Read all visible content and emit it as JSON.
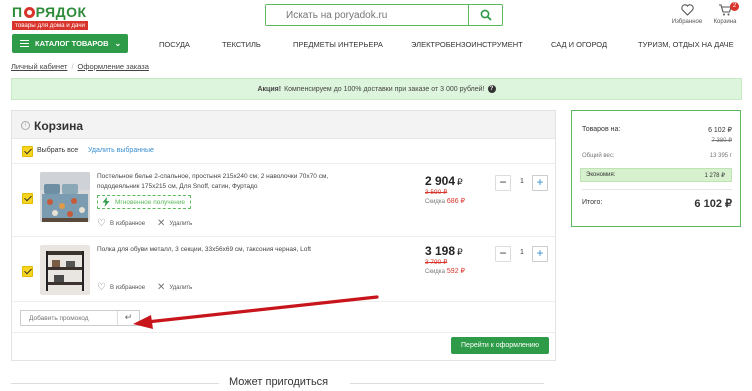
{
  "header": {
    "logo_text": "ПОРЯДОК",
    "logo_sub": "товары для дома и дачи",
    "search_placeholder": "Искать на poryadok.ru",
    "favorites_label": "Избранное",
    "cart_label": "Корзина",
    "cart_count": "2"
  },
  "nav": {
    "catalog_label": "КАТАЛОГ ТОВАРОВ",
    "items": [
      "ПОСУДА",
      "ТЕКСТИЛЬ",
      "ПРЕДМЕТЫ ИНТЕРЬЕРА",
      "ЭЛЕКТРОБЕНЗОИНСТРУМЕНТ",
      "САД И ОГОРОД",
      "ТУРИЗМ, ОТДЫХ НА ДАЧЕ"
    ]
  },
  "breadcrumb": [
    "Личный кабинет",
    "Оформление заказа"
  ],
  "promo": {
    "bold": "Акция!",
    "text": "Компенсируем до 100% доставки при заказе от 3 000 рублей!",
    "help_glyph": "?"
  },
  "cart": {
    "title": "Корзина",
    "select_all": "Выбрать все",
    "delete_selected": "Удалить выбранные",
    "favorites_action": "В избранное",
    "delete_action": "Удалить",
    "items": [
      {
        "title": "Постельное белье 2-спальное, простыня 215x240 см, 2 наволочки 70x70 см, пододеяльник 175x215 см, Для Snoff, сатин, Фуртадо",
        "instant_label": "Мгновенное получение",
        "price": "2 904",
        "currency": "₽",
        "old_price": "3 590 ₽",
        "discount_label": "Скидка",
        "discount_value": "686 ₽",
        "qty": "1"
      },
      {
        "title": "Полка для обуви металл, 3 секции, 33x56x69 см, таксония черная, Loft",
        "price": "3 198",
        "currency": "₽",
        "old_price": "3 790 ₽",
        "discount_label": "Скидка",
        "discount_value": "592 ₽",
        "qty": "1"
      }
    ],
    "promo_placeholder": "Добавить промокод",
    "promo_apply_glyph": "↵",
    "checkout_label": "Перейти к оформлению"
  },
  "summary": {
    "goods_label": "Товаров на:",
    "goods_value": "6 102 ₽",
    "goods_old": "7 380 ₽",
    "weight_label": "Общий вес:",
    "weight_value": "13 395 г",
    "economy_label": "Экономия:",
    "economy_value": "1 278 ₽",
    "total_label": "Итого:",
    "total_value": "6 102 ₽"
  },
  "recommend_heading": "Может пригодиться",
  "colors": {
    "brand_green": "#2e9b48",
    "brand_red": "#d9342b",
    "checkbox_yellow": "#f7d51d",
    "link_blue": "#3a8fd0",
    "annotation_arrow": "#c8151b"
  }
}
